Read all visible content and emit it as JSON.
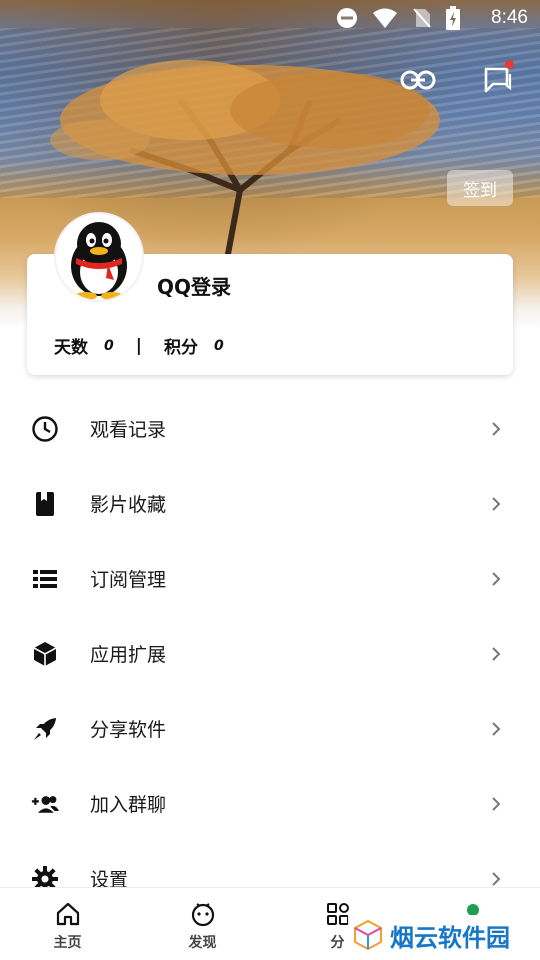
{
  "status_bar": {
    "time": "8:46"
  },
  "header": {
    "checkin_label": "签到"
  },
  "profile": {
    "login_label": "QQ登录",
    "days_label": "天数",
    "days_value": "0",
    "separator": "|",
    "points_label": "积分",
    "points_value": "0"
  },
  "menu": {
    "items": [
      {
        "label": "观看记录",
        "icon": "clock-icon"
      },
      {
        "label": "影片收藏",
        "icon": "bookmark-icon"
      },
      {
        "label": "订阅管理",
        "icon": "list-icon"
      },
      {
        "label": "应用扩展",
        "icon": "cube-icon"
      },
      {
        "label": "分享软件",
        "icon": "rocket-icon"
      },
      {
        "label": "加入群聊",
        "icon": "add-group-icon"
      },
      {
        "label": "设置",
        "icon": "gear-icon"
      }
    ]
  },
  "bottom_nav": {
    "items": [
      {
        "label": "主页",
        "icon": "home-icon"
      },
      {
        "label": "发现",
        "icon": "discover-icon"
      },
      {
        "label": "分",
        "icon": "category-icon"
      },
      {
        "label": "",
        "icon": "profile-dot"
      }
    ]
  },
  "watermark": {
    "text": "烟云软件园"
  },
  "colors": {
    "accent_green": "#1f9d55",
    "notification_red": "#e53935",
    "watermark_blue": "#1677c9"
  }
}
